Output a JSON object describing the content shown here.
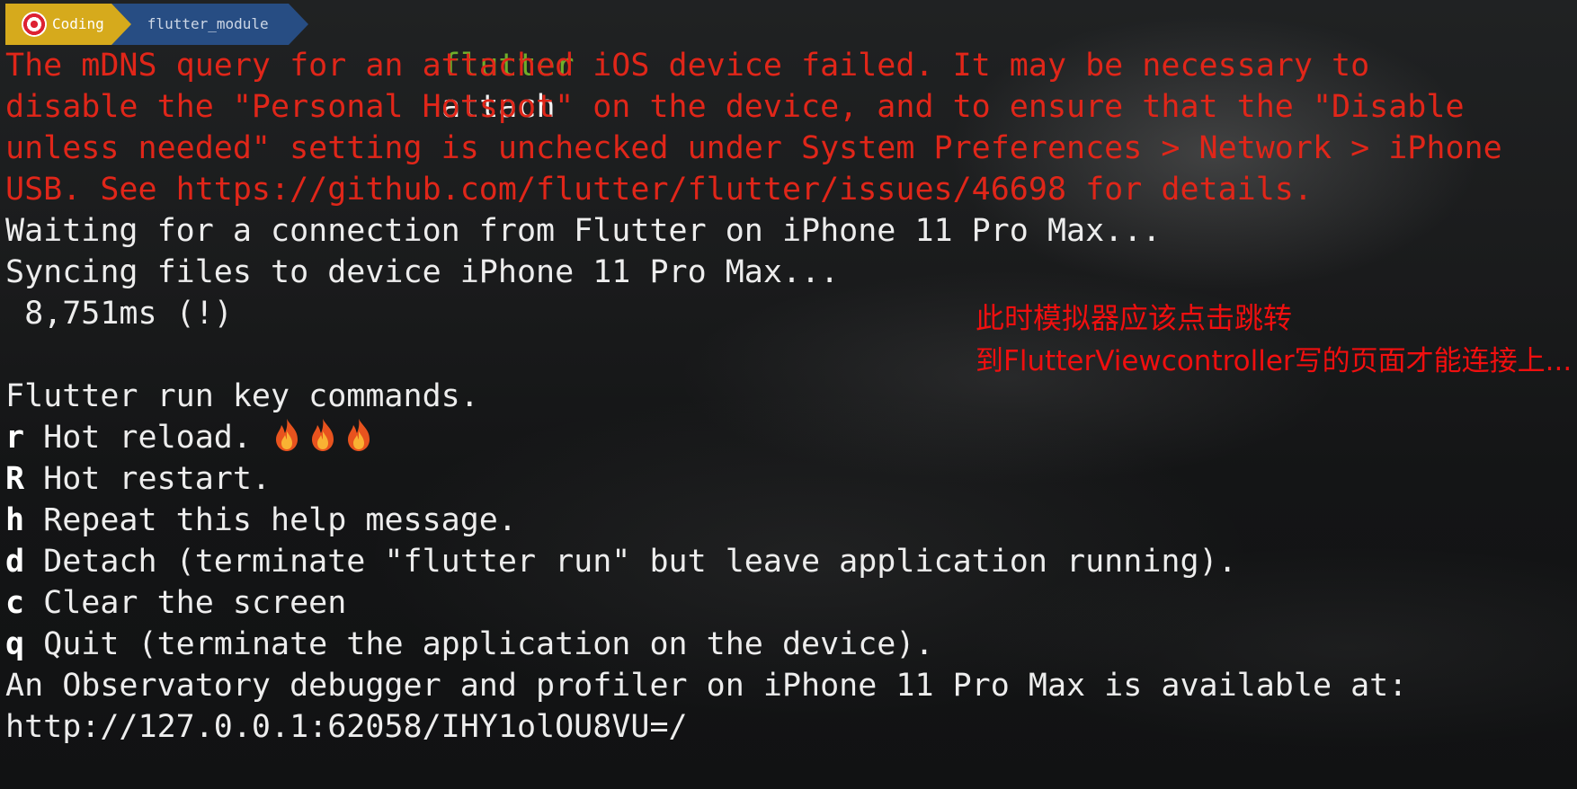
{
  "prompt": {
    "segment_user": "Coding",
    "segment_dir": "flutter_module",
    "command": "flutter",
    "argument": "attach"
  },
  "lines": {
    "err1": "The mDNS query for an attached iOS device failed. It may be necessary to",
    "err2": "disable the \"Personal Hotspot\" on the device, and to ensure that the \"Disable",
    "err3": "unless needed\" setting is unchecked under System Preferences > Network > iPhone",
    "err4": "USB. See https://github.com/flutter/flutter/issues/46698 for details.",
    "waiting": "Waiting for a connection from Flutter on iPhone 11 Pro Max...",
    "syncing": "Syncing files to device iPhone 11 Pro Max...",
    "timing": " 8,751ms (!)",
    "blank": "",
    "commands_header": "Flutter run key commands.",
    "observatory": "An Observatory debugger and profiler on iPhone 11 Pro Max is available at:",
    "url": "http://127.0.0.1:62058/IHY1olOU8VU=/"
  },
  "key_commands": [
    {
      "key": "r",
      "text": " Hot reload."
    },
    {
      "key": "R",
      "text": " Hot restart."
    },
    {
      "key": "h",
      "text": " Repeat this help message."
    },
    {
      "key": "d",
      "text": " Detach (terminate \"flutter run\" but leave application running)."
    },
    {
      "key": "c",
      "text": " Clear the screen"
    },
    {
      "key": "q",
      "text": " Quit (terminate the application on the device)."
    }
  ],
  "icons": {
    "prompt_icon": "target-icon",
    "reload_icon": "fire-icon",
    "reload_icon_count": 3
  },
  "annotation": {
    "line1": "此时模拟器应该点击跳转",
    "line2": "到FlutterViewcontroller写的页面才能连接上..."
  },
  "colors": {
    "error": "#e02619",
    "command": "#6fae2a",
    "segment_user_bg": "#d6aa1c",
    "segment_dir_bg": "#274d83",
    "annotation": "#f00f0f"
  }
}
